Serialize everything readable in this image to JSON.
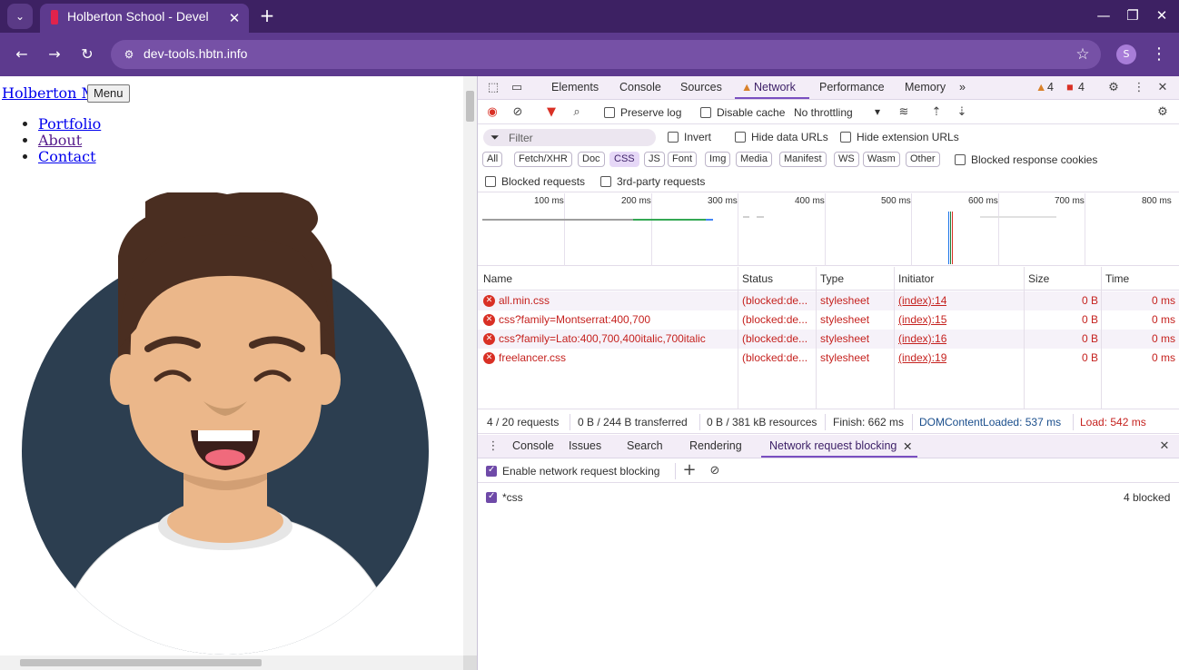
{
  "browser": {
    "tab_title": "Holberton School - Devel",
    "url": "dev-tools.hbtn.info",
    "profile_initial": "S"
  },
  "page": {
    "brand": "Holberton Me",
    "menu_button": "Menu",
    "nav": [
      "Portfolio",
      "About",
      "Contact"
    ]
  },
  "devtools": {
    "tabs": [
      "Elements",
      "Console",
      "Sources",
      "Network",
      "Performance",
      "Memory"
    ],
    "active_tab": "Network",
    "warnings": "4",
    "errors": "4",
    "preserve_log": "Preserve log",
    "disable_cache": "Disable cache",
    "throttling": "No throttling",
    "filter_placeholder": "Filter",
    "invert": "Invert",
    "hide_data_urls": "Hide data URLs",
    "hide_extension_urls": "Hide extension URLs",
    "type_filters": [
      "All",
      "Fetch/XHR",
      "Doc",
      "CSS",
      "JS",
      "Font",
      "Img",
      "Media",
      "Manifest",
      "WS",
      "Wasm",
      "Other"
    ],
    "selected_type": "CSS",
    "blocked_response_cookies": "Blocked response cookies",
    "blocked_requests": "Blocked requests",
    "third_party_requests": "3rd-party requests",
    "timeline_ticks": [
      "100 ms",
      "200 ms",
      "300 ms",
      "400 ms",
      "500 ms",
      "600 ms",
      "700 ms",
      "800 ms"
    ],
    "columns": [
      "Name",
      "Status",
      "Type",
      "Initiator",
      "Size",
      "Time"
    ],
    "rows": [
      {
        "name": "all.min.css",
        "status": "(blocked:de...",
        "type": "stylesheet",
        "initiator": "(index):14",
        "size": "0 B",
        "time": "0 ms"
      },
      {
        "name": "css?family=Montserrat:400,700",
        "status": "(blocked:de...",
        "type": "stylesheet",
        "initiator": "(index):15",
        "size": "0 B",
        "time": "0 ms"
      },
      {
        "name": "css?family=Lato:400,700,400italic,700italic",
        "status": "(blocked:de...",
        "type": "stylesheet",
        "initiator": "(index):16",
        "size": "0 B",
        "time": "0 ms"
      },
      {
        "name": "freelancer.css",
        "status": "(blocked:de...",
        "type": "stylesheet",
        "initiator": "(index):19",
        "size": "0 B",
        "time": "0 ms"
      }
    ],
    "summary": {
      "requests": "4 / 20 requests",
      "transferred": "0 B / 244 B transferred",
      "resources": "0 B / 381 kB resources",
      "finish": "Finish: 662 ms",
      "dom_content_loaded": "DOMContentLoaded: 537 ms",
      "load": "Load: 542 ms"
    },
    "drawer_tabs": [
      "Console",
      "Issues",
      "Search",
      "Rendering",
      "Network request blocking"
    ],
    "enable_blocking": "Enable network request blocking",
    "pattern": "*css",
    "blocked_count": "4 blocked"
  }
}
